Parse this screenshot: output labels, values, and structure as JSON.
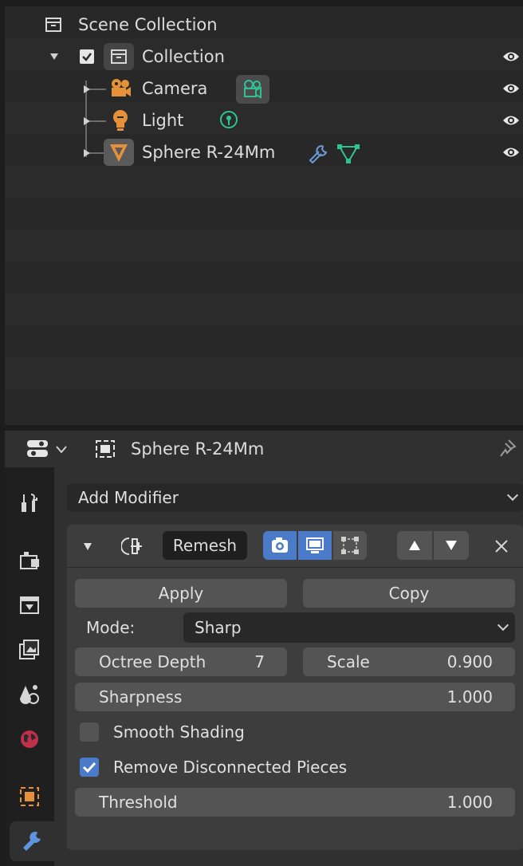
{
  "outliner": {
    "root_label": "Scene Collection",
    "items": [
      {
        "label": "Collection"
      },
      {
        "label": "Camera"
      },
      {
        "label": "Light"
      },
      {
        "label": "Sphere R-24Mm"
      }
    ]
  },
  "properties": {
    "object_name": "Sphere R-24Mm",
    "add_modifier_label": "Add Modifier",
    "modifier": {
      "name": "Remesh",
      "apply_label": "Apply",
      "copy_label": "Copy",
      "mode_label": "Mode:",
      "mode_value": "Sharp",
      "octree_depth_label": "Octree Depth",
      "octree_depth_value": "7",
      "scale_label": "Scale",
      "scale_value": "0.900",
      "sharpness_label": "Sharpness",
      "sharpness_value": "1.000",
      "smooth_shading_label": "Smooth Shading",
      "smooth_shading_checked": false,
      "remove_disconnected_label": "Remove Disconnected Pieces",
      "remove_disconnected_checked": true,
      "threshold_label": "Threshold",
      "threshold_value": "1.000"
    }
  },
  "colors": {
    "accent_blue": "#4a7ac8",
    "object_orange": "#e5913a",
    "data_green": "#2fc393",
    "modifier_blue": "#6a9bd8"
  }
}
